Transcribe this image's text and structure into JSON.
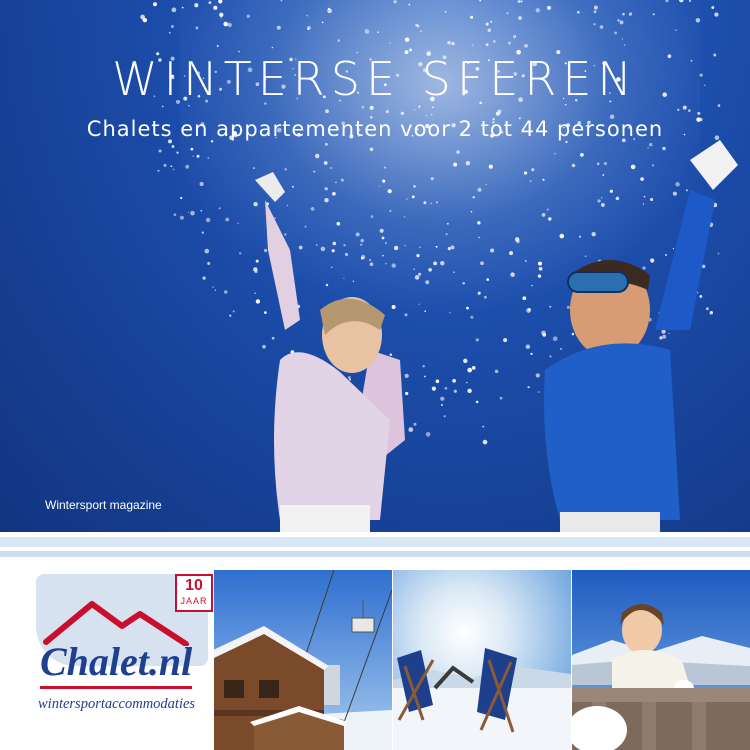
{
  "hero": {
    "title": "WINTERSE SFEREN",
    "subtitle": "Chalets en appartementen voor 2 tot 44 personen",
    "magazine_label": "Wintersport magazine"
  },
  "logo": {
    "anniversary_number": "10",
    "anniversary_word": "JAAR",
    "brand_name": "Chalet.nl",
    "tagline": "wintersportaccommodaties"
  },
  "colors": {
    "sky_blue": "#1d4fae",
    "brand_blue": "#1f3f8f",
    "brand_red": "#c8102e",
    "stripe_light": "#d9e6f4"
  },
  "photos": [
    {
      "subject": "chalet-with-ski-lift"
    },
    {
      "subject": "deck-chairs-on-snow"
    },
    {
      "subject": "child-on-balcony"
    }
  ]
}
